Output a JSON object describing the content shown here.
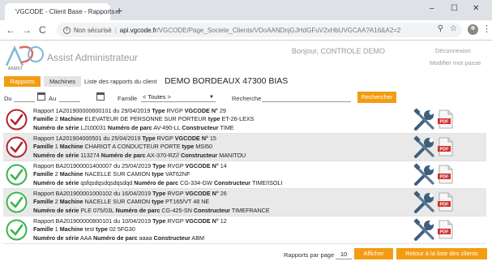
{
  "browser": {
    "tab_title": "VGCODE - Client Base - Rapports",
    "tab_close": "×",
    "new_tab": "+",
    "window_controls": [
      "–",
      "☐",
      "✕"
    ],
    "back": "←",
    "forward": "→",
    "reload": "C",
    "security_label": "Non sécurisé",
    "url_host": "api.vgcode.fr",
    "url_path": "/VGCODE/Page_Societe_Clients/VDoAANDnjGJHdGFuV2xHbUVGCAA?A16&A2=2",
    "menu": "⋮"
  },
  "header": {
    "logo_text": "ASSIST",
    "title": "Assist Administrateur",
    "greeting": "Bonjour, CONTROLE DEMO",
    "logout": "Déconnexion",
    "change_password": "Modifier mot passe"
  },
  "tabs": [
    {
      "label": "Rapports",
      "active": true
    },
    {
      "label": "Machines",
      "active": false
    }
  ],
  "list_label": "Liste des rapports du client",
  "client_name": "DEMO BORDEAUX 47300 BIAS",
  "filters": {
    "du_label": "Du",
    "au_label": "Au",
    "famille_label": "Famille",
    "famille_value": "< Toutes >",
    "recherche_label": "Recherche",
    "search_button": "Rechercher"
  },
  "colors": {
    "accent": "#f39c12",
    "ok": "#3bb34a",
    "ko": "#b0252b"
  },
  "reports": [
    {
      "status": "ko",
      "rapport": "1A201900000600101",
      "date": "29/04/2019",
      "type": "RVGP",
      "vgcode": "29",
      "famille": "2",
      "machine": "ELEVATEUR DE PERSONNE SUR PORTEUR",
      "machine_type": "ET-26-LEXS",
      "serie": "LJ100031",
      "parc": "AV-490-LL",
      "constructeur": "TIME"
    },
    {
      "status": "ko",
      "rapport": "1A201904000501",
      "date": "25/04/2019",
      "type": "RVGP",
      "vgcode": "15",
      "famille": "1",
      "machine": "CHARIOT A CONDUCTEUR PORTE",
      "machine_type": "MSI50",
      "serie": "113274",
      "parc": "AX-370-RZ//",
      "constructeur": "MANITOU"
    },
    {
      "status": "ok",
      "rapport": "BA201900001400007",
      "date": "25/04/2019",
      "type": "RVGP",
      "vgcode": "14",
      "famille": "2",
      "machine": "NACELLE SUR CAMION",
      "machine_type": "VAT62NF",
      "serie": "qsfqsdqsdqsdqsdqd",
      "parc": "CG-334-GW",
      "constructeur": "TIME/ISOLI"
    },
    {
      "status": "ok",
      "rapport": "BA201900001000102",
      "date": "16/04/2019",
      "type": "RVGP",
      "vgcode": "26",
      "famille": "2",
      "machine": "NACELLE SUR CAMION",
      "machine_type": "PT165/VT 48 NE",
      "serie": "PLE 075/03L",
      "parc": "CG-425-SN",
      "constructeur": "TIMEFRANCE"
    },
    {
      "status": "ok",
      "rapport": "BA201900000800101",
      "date": "10/04/2019",
      "type": "RVGP",
      "vgcode": "12",
      "famille": "1",
      "machine": "test",
      "machine_type": "02 5FG30",
      "serie": "AAA",
      "parc": "aaaa",
      "constructeur": "ABM"
    }
  ],
  "labels": {
    "rapport": "Rapport",
    "du": "du",
    "type": "Type",
    "vgcode": "VGCODE N°",
    "famille": "Famille",
    "machine": "Machine",
    "machine_type": "type",
    "serie": "Numéro de série",
    "parc": "Numéro de parc",
    "constructeur": "Constructeur",
    "pdf": "PDF"
  },
  "footer": {
    "per_page_label": "Rapports par page",
    "per_page_value": "10",
    "afficher": "Afficher",
    "back_to_clients": "Retour à la liste des clients"
  }
}
